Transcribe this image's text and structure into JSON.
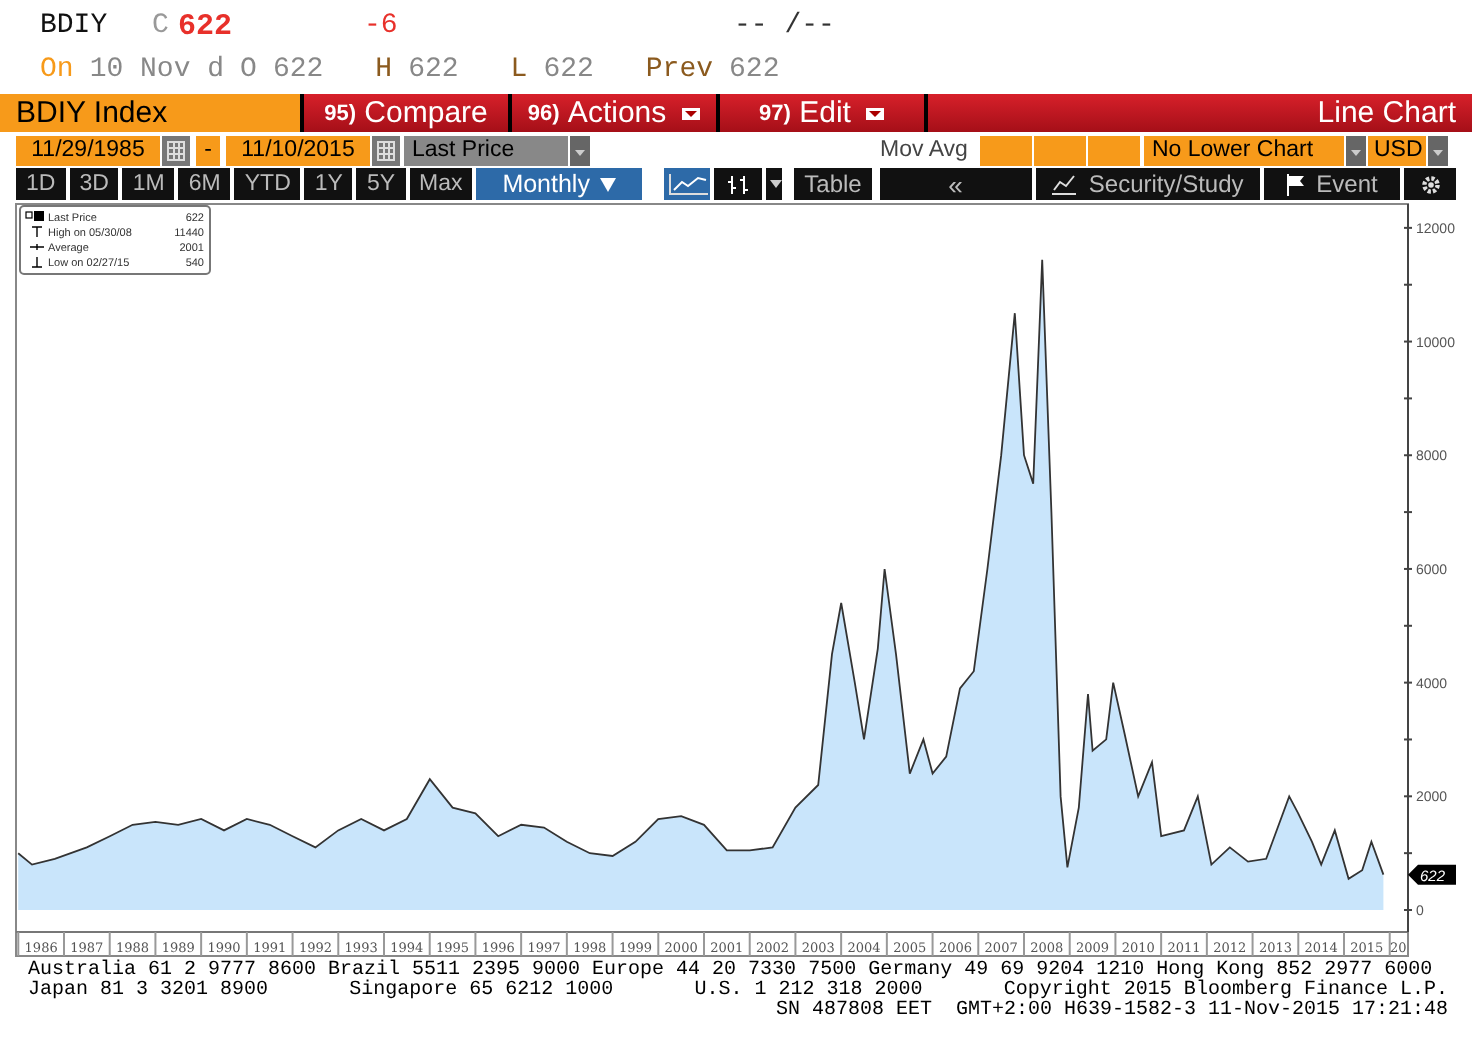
{
  "quote": {
    "ticker": "BDIY",
    "close_label": "C",
    "close": "622",
    "change": "-6",
    "time": "-- /--",
    "on_label": "On",
    "date": "10 Nov d",
    "open_label": "O",
    "open": "622",
    "high_label": "H",
    "high": "622",
    "low_label": "L",
    "low": "622",
    "prev_label": "Prev",
    "prev": "622"
  },
  "toolbar": {
    "security": "BDIY Index",
    "menus": [
      {
        "number": "95)",
        "label": "Compare",
        "dropdown": false
      },
      {
        "number": "96)",
        "label": "Actions",
        "dropdown": true
      },
      {
        "number": "97)",
        "label": "Edit",
        "dropdown": true
      }
    ],
    "chart_type": "Line Chart"
  },
  "settings": {
    "start_date": "11/29/1985",
    "separator": "-",
    "end_date": "11/10/2015",
    "field": "Last Price",
    "study": "Mov Avg",
    "lower_chart": "No Lower Chart",
    "currency": "USD"
  },
  "periods": [
    {
      "label": "1D",
      "selected": false
    },
    {
      "label": "3D",
      "selected": false
    },
    {
      "label": "1M",
      "selected": false
    },
    {
      "label": "6M",
      "selected": false
    },
    {
      "label": "YTD",
      "selected": false
    },
    {
      "label": "1Y",
      "selected": false
    },
    {
      "label": "5Y",
      "selected": false
    },
    {
      "label": "Max",
      "selected": false
    }
  ],
  "frequency": {
    "label": "Monthly",
    "selected": true
  },
  "chart_styles": [
    {
      "kind": "line",
      "selected": true
    },
    {
      "kind": "bars",
      "selected": false
    }
  ],
  "table_button": "Table",
  "right_tools": {
    "back": "«",
    "study": "Security/Study",
    "event": "Event"
  },
  "chart": {
    "legend": [
      {
        "kind": "last",
        "label": "Last Price",
        "value": "622"
      },
      {
        "kind": "high",
        "label": "High on 05/30/08",
        "value": "11440"
      },
      {
        "kind": "average",
        "label": "Average",
        "value": "2001"
      },
      {
        "kind": "low",
        "label": "Low on 02/27/15",
        "value": "540"
      }
    ],
    "last_tag": "622",
    "x_label_cut": "20",
    "chart_data": {
      "type": "area",
      "x": [
        1985.5,
        1985.8,
        1986.3,
        1987.0,
        1987.5,
        1988.0,
        1988.5,
        1989.0,
        1989.5,
        1990.0,
        1990.5,
        1991.0,
        1991.5,
        1992.0,
        1992.5,
        1993.0,
        1993.5,
        1994.0,
        1994.5,
        1995.0,
        1995.5,
        1996.0,
        1996.5,
        1997.0,
        1997.5,
        1998.0,
        1998.5,
        1999.0,
        1999.5,
        2000.0,
        2000.5,
        2001.0,
        2001.5,
        2002.0,
        2002.5,
        2003.0,
        2003.3,
        2003.5,
        2003.8,
        2004.0,
        2004.3,
        2004.45,
        2004.7,
        2005.0,
        2005.3,
        2005.5,
        2005.8,
        2006.1,
        2006.4,
        2006.7,
        2007.0,
        2007.3,
        2007.5,
        2007.7,
        2007.8,
        2007.9,
        2008.1,
        2008.3,
        2008.45,
        2008.7,
        2008.9,
        2009.0,
        2009.3,
        2009.45,
        2009.7,
        2010.0,
        2010.3,
        2010.5,
        2011.0,
        2011.3,
        2011.6,
        2012.0,
        2012.4,
        2012.8,
        2013.3,
        2013.5,
        2013.8,
        2014.0,
        2014.3,
        2014.6,
        2014.9,
        2015.1,
        2015.36
      ],
      "series": [
        {
          "color": "#c9e5fb",
          "values": [
            1000,
            800,
            900,
            1100,
            1300,
            1500,
            1550,
            1500,
            1600,
            1400,
            1600,
            1500,
            1300,
            1100,
            1400,
            1600,
            1400,
            1600,
            2300,
            1800,
            1700,
            1300,
            1500,
            1450,
            1200,
            1000,
            950,
            1200,
            1600,
            1650,
            1500,
            1050,
            1050,
            1100,
            1800,
            2200,
            4500,
            5400,
            4000,
            3000,
            4600,
            6000,
            4500,
            2400,
            3000,
            2400,
            2700,
            3900,
            4200,
            6000,
            8000,
            10500,
            8000,
            7500,
            9500,
            11440,
            7000,
            2000,
            750,
            1800,
            3800,
            2800,
            3000,
            4000,
            3100,
            2000,
            2600,
            1300,
            1400,
            2000,
            800,
            1100,
            850,
            900,
            2000,
            1700,
            1200,
            800,
            1400,
            550,
            700,
            1200,
            622
          ]
        }
      ],
      "xlim": [
        1985.45,
        2015.9
      ],
      "ylim": [
        0,
        12420
      ],
      "yticks": [
        0,
        2000,
        4000,
        6000,
        8000,
        10000,
        12000
      ],
      "xticks": [
        1986,
        1987,
        1988,
        1989,
        1990,
        1991,
        1992,
        1993,
        1994,
        1995,
        1996,
        1997,
        1998,
        1999,
        2000,
        2001,
        2002,
        2003,
        2004,
        2005,
        2006,
        2007,
        2008,
        2009,
        2010,
        2011,
        2012,
        2013,
        2014,
        2015
      ]
    }
  },
  "footer": {
    "line_1": "Australia 61 2 9777 8600 Brazil 5511 2395 9000 Europe 44 20 7330 7500 Germany 49 69 9204 1210 Hong Kong 852 2977 6000",
    "line_2": [
      "Japan 81 3 3201 8900",
      "Singapore 65 6212 1000",
      "U.S. 1 212 318 2000",
      "Copyright 2015 Bloomberg Finance L.P."
    ],
    "line_3": [
      "SN 487808 EET",
      "GMT+2:00 H639-1582-3 11-Nov-2015 17:21:48"
    ]
  }
}
